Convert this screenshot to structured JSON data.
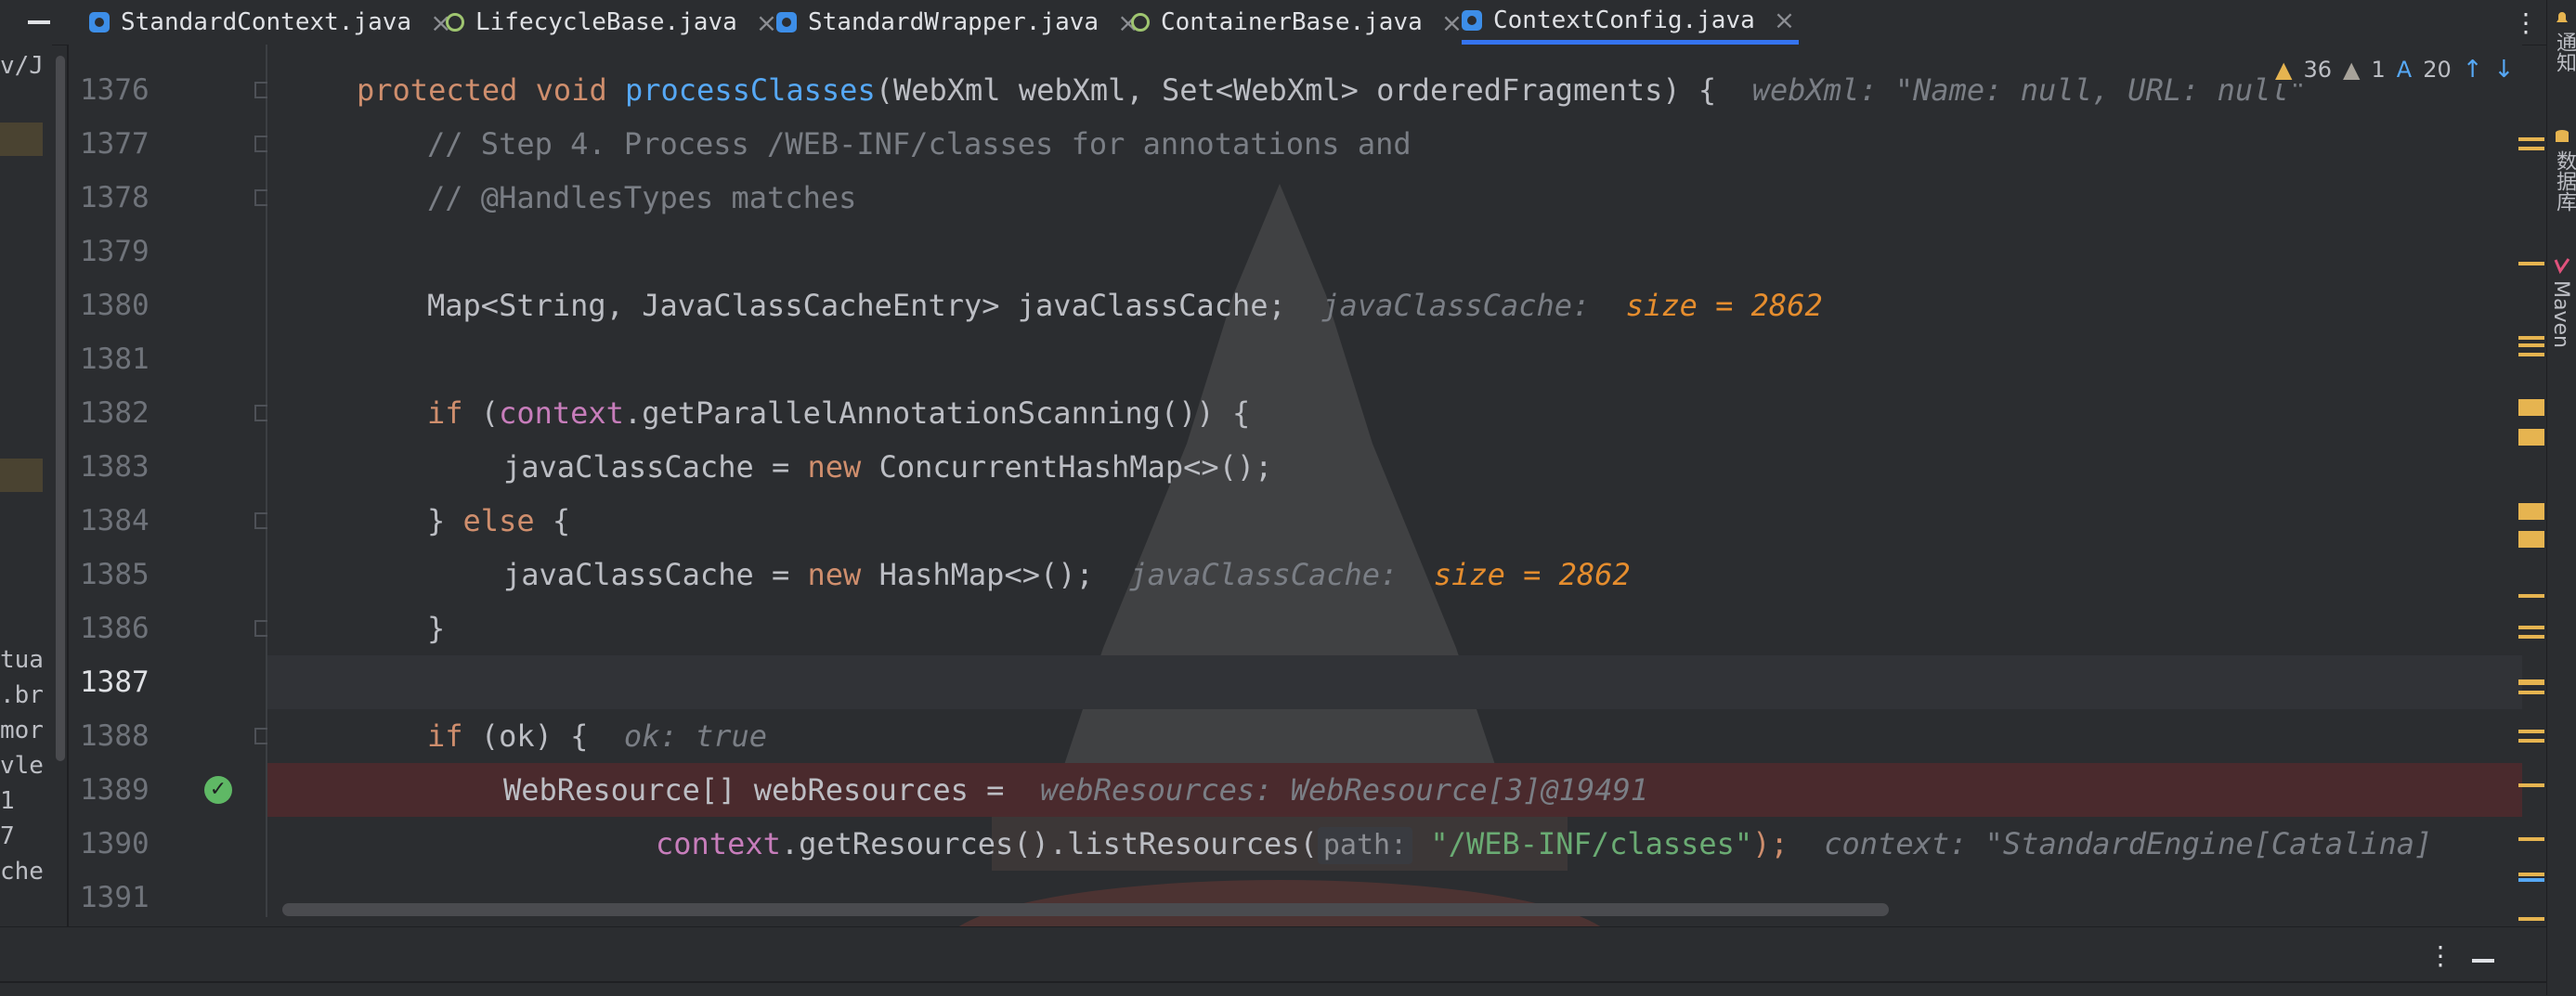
{
  "tabs": [
    {
      "label": "StandardContext.java",
      "icon": "class-icon",
      "active": false
    },
    {
      "label": "LifecycleBase.java",
      "icon": "abstract-class-icon",
      "active": false
    },
    {
      "label": "StandardWrapper.java",
      "icon": "class-icon",
      "active": false
    },
    {
      "label": "ContainerBase.java",
      "icon": "abstract-class-icon",
      "active": false
    },
    {
      "label": "ContextConfig.java",
      "icon": "class-icon",
      "active": true
    }
  ],
  "close_glyph": "×",
  "more_glyph": "⋮",
  "left_panel_fragments": [
    "v/J",
    "tua",
    ".br",
    "mor",
    "vle",
    "1",
    "7",
    "che"
  ],
  "inspections": {
    "warnings": "36",
    "weak_warnings": "1",
    "typos": "20"
  },
  "line_numbers": [
    "1376",
    "1377",
    "1378",
    "1379",
    "1380",
    "1381",
    "1382",
    "1383",
    "1384",
    "1385",
    "1386",
    "1387",
    "1388",
    "1389",
    "1390",
    "1391"
  ],
  "current_line": "1387",
  "code": {
    "l1376": {
      "kw": "protected void ",
      "fn": "processClasses",
      "rest": "(WebXml webXml, Set<WebXml> orderedFragments) {",
      "dbg": "webXml: \"Name: null, URL: null\""
    },
    "l1377": "// Step 4. Process /WEB-INF/classes for annotations and",
    "l1378": "// @HandlesTypes matches",
    "l1380": {
      "text": "Map<String, JavaClassCacheEntry> javaClassCache;",
      "dbg_name": "javaClassCache:",
      "dbg_val": "size = 2862"
    },
    "l1382": {
      "kw": "if ",
      "p1": "(",
      "fld": "context",
      "rest": ".getParallelAnnotationScanning()) {"
    },
    "l1383": {
      "a": "javaClassCache = ",
      "kw": "new ",
      "b": "ConcurrentHashMap<>();"
    },
    "l1384": {
      "a": "} ",
      "kw": "else",
      "b": " {"
    },
    "l1385": {
      "a": "javaClassCache = ",
      "kw": "new ",
      "b": "HashMap<>();",
      "dbg_name": "javaClassCache:",
      "dbg_val": "size = 2862"
    },
    "l1386": "}",
    "l1388": {
      "kw": "if ",
      "rest": "(ok) {",
      "dbg": "ok: true"
    },
    "l1389": {
      "text": "WebResource[] webResources =",
      "dbg": "webResources: WebResource[3]@19491"
    },
    "l1390": {
      "fld": "context",
      "rest": ".getResources().listResources(",
      "hint": "path:",
      "str": "\"/WEB-INF/classes\"",
      "end": ");",
      "dbg": "context: \"StandardEngine[Catalina]"
    }
  },
  "right_tools": [
    {
      "label": "通知",
      "icon": "bell-icon"
    },
    {
      "label": "数据库",
      "icon": "database-icon"
    },
    {
      "label": "Maven",
      "icon": "maven-icon"
    }
  ],
  "colors": {
    "keyword": "#cf8e6d",
    "function": "#56a8f5",
    "comment": "#7a7e85",
    "string": "#6aab73",
    "field": "#c77dbb",
    "debug_value": "#e58d2e",
    "warning": "#e6b450"
  }
}
